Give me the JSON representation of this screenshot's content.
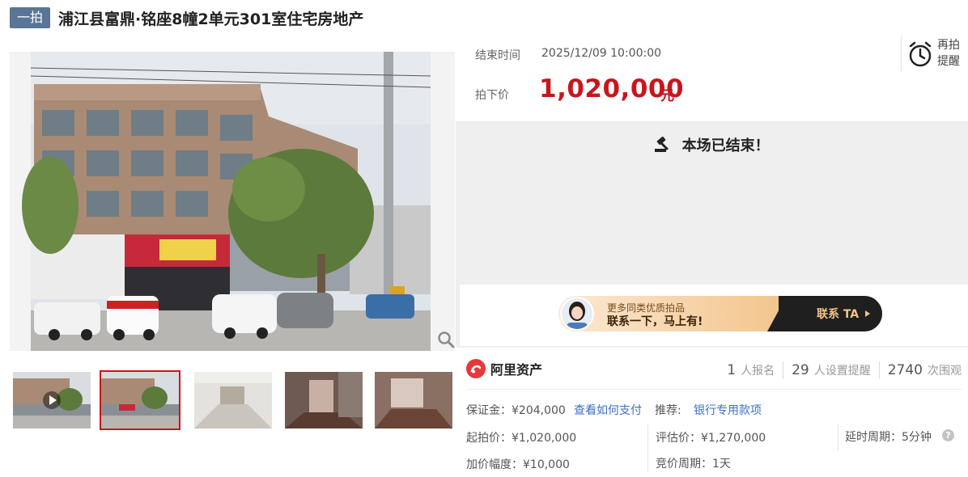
{
  "header": {
    "badge": "一拍",
    "title": "浦江县富鼎·铭座8幢2单元301室住宅房地产"
  },
  "info": {
    "end_time_label": "结束时间",
    "end_time_value": "2025/12/09 10:00:00",
    "final_price_label": "拍下价",
    "final_price_value": "1,020,000",
    "final_price_unit": "元"
  },
  "remind": {
    "label_line1": "再拍",
    "label_line2": "提醒"
  },
  "status": {
    "ended_message": "本场已结束！"
  },
  "banner": {
    "subtitle": "更多同类优质拍品",
    "title": "联系一下，马上有!",
    "contact": "联系 TA"
  },
  "platform": {
    "name": "阿里资产"
  },
  "stats": [
    {
      "num": "1",
      "label": "人报名"
    },
    {
      "num": "29",
      "label": "人设置提醒"
    },
    {
      "num": "2740",
      "label": "次围观"
    }
  ],
  "details": {
    "deposit": "保证金：¥204,000",
    "how_to_pay": "查看如何支付",
    "recommend_label": "推荐:",
    "recommend_link": "银行专用款项",
    "start_price": "起拍价：¥1,020,000",
    "appraisal": "评估价：¥1,270,000",
    "delay": "延时周期：5分钟",
    "increment": "加价幅度：¥10,000",
    "bid_cycle": "竞价周期：1天"
  },
  "icons": {
    "help": "?"
  },
  "colors": {
    "accent": "#c8161d",
    "badge": "#5a7597",
    "link": "#3a6fc8"
  }
}
